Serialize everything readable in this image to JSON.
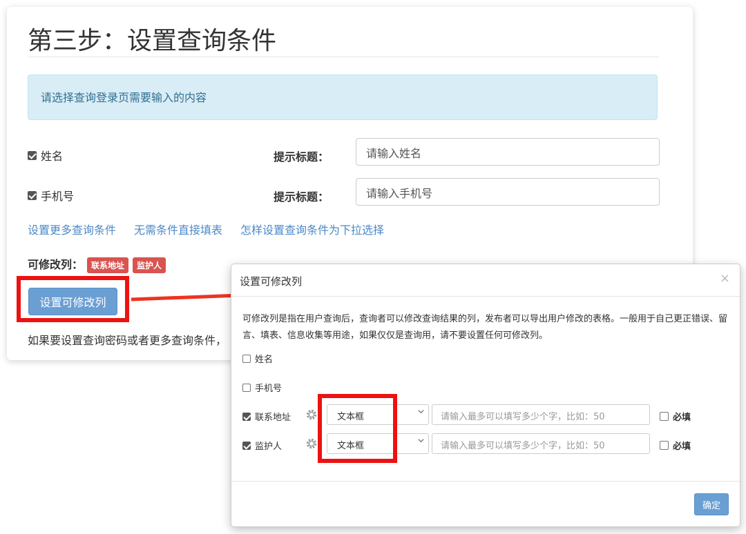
{
  "main": {
    "title": "第三步：设置查询条件",
    "alert": "请选择查询登录页需要输入的内容",
    "fields": [
      {
        "label": "姓名",
        "checked": true,
        "hint_label": "提示标题：",
        "input_value": "请输入姓名"
      },
      {
        "label": "手机号",
        "checked": true,
        "hint_label": "提示标题：",
        "input_value": "请输入手机号"
      }
    ],
    "links": [
      "设置更多查询条件",
      "无需条件直接填表",
      "怎样设置查询条件为下拉选择"
    ],
    "editable_label": "可修改列：",
    "editable_tags": [
      "联系地址",
      "监护人"
    ],
    "set_button": "设置可修改列",
    "footer_text": "如果要设置查询密码或者更多查询条件，"
  },
  "modal": {
    "title": "设置可修改列",
    "close": "×",
    "description": "可修改列是指在用户查询后，查询者可以修改查询结果的列，发布者可以导出用户修改的表格。一般用于自己更正错误、留言、填表、信息收集等用途，如果仅仅是查询用，请不要设置任何可修改列。",
    "rows": [
      {
        "label": "姓名",
        "checked": false
      },
      {
        "label": "手机号",
        "checked": false
      },
      {
        "label": "联系地址",
        "checked": true,
        "type": "文本框",
        "placeholder": "请输入最多可以填写多少个字，比如：50",
        "required_label": "必填",
        "required": false
      },
      {
        "label": "监护人",
        "checked": true,
        "type": "文本框",
        "placeholder": "请输入最多可以填写多少个字，比如：50",
        "required_label": "必填",
        "required": false
      }
    ],
    "confirm_button": "确定"
  },
  "colors": {
    "primary": "#6a9fd4",
    "danger_tag": "#d9534f",
    "alert_bg": "#d9edf7",
    "alert_text": "#31708f",
    "link": "#4b89c8",
    "highlight_red": "#ee1111"
  }
}
